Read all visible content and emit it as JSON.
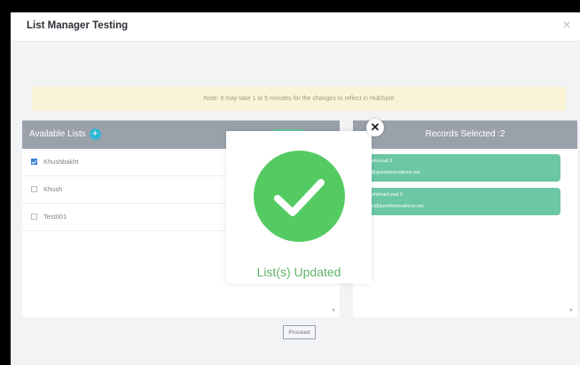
{
  "modal_window": {
    "title": "List Manager Testing",
    "close_icon": "×",
    "note": "Note: It may take 1 to 5 minutes for the changes to reflect in HubSpot",
    "proceed_label": "Proceed"
  },
  "available_lists": {
    "header": "Available Lists",
    "add_icon": "+",
    "items": [
      {
        "label": "Khushbakht",
        "checked": true
      },
      {
        "label": "Khush",
        "checked": false
      },
      {
        "label": "Test001",
        "checked": false
      }
    ],
    "scroll_icon": "▼"
  },
  "records_selected": {
    "header": "Records Selected :2",
    "records": [
      {
        "name": "KhushLead 3",
        "email": "...n@questinnovations.net"
      },
      {
        "name": "WhishkhanLead 2",
        "email": "...we@questinnovations.net"
      }
    ],
    "scroll_icon": "▼"
  },
  "success_popup": {
    "message": "List(s) Updated",
    "close_icon": "✕",
    "check_icon": "check-icon",
    "accent_color": "#54cb62"
  },
  "colors": {
    "panel_header": "#9aa1ab",
    "note_bg": "#fbf3d5",
    "record_card": "#6cc7a4",
    "add_button": "#33b6d6"
  }
}
